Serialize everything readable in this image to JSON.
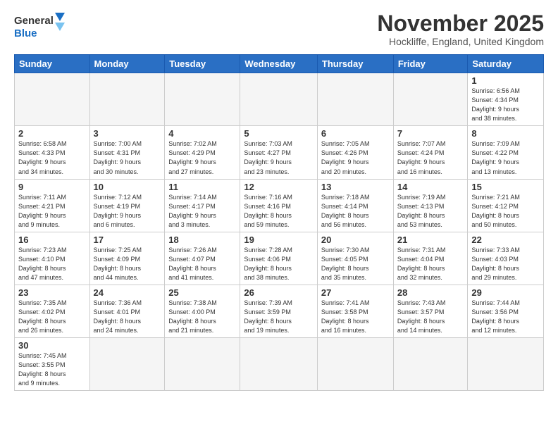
{
  "header": {
    "logo_text_general": "General",
    "logo_text_blue": "Blue",
    "month_title": "November 2025",
    "location": "Hockliffe, England, United Kingdom"
  },
  "weekdays": [
    "Sunday",
    "Monday",
    "Tuesday",
    "Wednesday",
    "Thursday",
    "Friday",
    "Saturday"
  ],
  "weeks": [
    [
      {
        "day": "",
        "info": ""
      },
      {
        "day": "",
        "info": ""
      },
      {
        "day": "",
        "info": ""
      },
      {
        "day": "",
        "info": ""
      },
      {
        "day": "",
        "info": ""
      },
      {
        "day": "",
        "info": ""
      },
      {
        "day": "1",
        "info": "Sunrise: 6:56 AM\nSunset: 4:34 PM\nDaylight: 9 hours\nand 38 minutes."
      }
    ],
    [
      {
        "day": "2",
        "info": "Sunrise: 6:58 AM\nSunset: 4:33 PM\nDaylight: 9 hours\nand 34 minutes."
      },
      {
        "day": "3",
        "info": "Sunrise: 7:00 AM\nSunset: 4:31 PM\nDaylight: 9 hours\nand 30 minutes."
      },
      {
        "day": "4",
        "info": "Sunrise: 7:02 AM\nSunset: 4:29 PM\nDaylight: 9 hours\nand 27 minutes."
      },
      {
        "day": "5",
        "info": "Sunrise: 7:03 AM\nSunset: 4:27 PM\nDaylight: 9 hours\nand 23 minutes."
      },
      {
        "day": "6",
        "info": "Sunrise: 7:05 AM\nSunset: 4:26 PM\nDaylight: 9 hours\nand 20 minutes."
      },
      {
        "day": "7",
        "info": "Sunrise: 7:07 AM\nSunset: 4:24 PM\nDaylight: 9 hours\nand 16 minutes."
      },
      {
        "day": "8",
        "info": "Sunrise: 7:09 AM\nSunset: 4:22 PM\nDaylight: 9 hours\nand 13 minutes."
      }
    ],
    [
      {
        "day": "9",
        "info": "Sunrise: 7:11 AM\nSunset: 4:21 PM\nDaylight: 9 hours\nand 9 minutes."
      },
      {
        "day": "10",
        "info": "Sunrise: 7:12 AM\nSunset: 4:19 PM\nDaylight: 9 hours\nand 6 minutes."
      },
      {
        "day": "11",
        "info": "Sunrise: 7:14 AM\nSunset: 4:17 PM\nDaylight: 9 hours\nand 3 minutes."
      },
      {
        "day": "12",
        "info": "Sunrise: 7:16 AM\nSunset: 4:16 PM\nDaylight: 8 hours\nand 59 minutes."
      },
      {
        "day": "13",
        "info": "Sunrise: 7:18 AM\nSunset: 4:14 PM\nDaylight: 8 hours\nand 56 minutes."
      },
      {
        "day": "14",
        "info": "Sunrise: 7:19 AM\nSunset: 4:13 PM\nDaylight: 8 hours\nand 53 minutes."
      },
      {
        "day": "15",
        "info": "Sunrise: 7:21 AM\nSunset: 4:12 PM\nDaylight: 8 hours\nand 50 minutes."
      }
    ],
    [
      {
        "day": "16",
        "info": "Sunrise: 7:23 AM\nSunset: 4:10 PM\nDaylight: 8 hours\nand 47 minutes."
      },
      {
        "day": "17",
        "info": "Sunrise: 7:25 AM\nSunset: 4:09 PM\nDaylight: 8 hours\nand 44 minutes."
      },
      {
        "day": "18",
        "info": "Sunrise: 7:26 AM\nSunset: 4:07 PM\nDaylight: 8 hours\nand 41 minutes."
      },
      {
        "day": "19",
        "info": "Sunrise: 7:28 AM\nSunset: 4:06 PM\nDaylight: 8 hours\nand 38 minutes."
      },
      {
        "day": "20",
        "info": "Sunrise: 7:30 AM\nSunset: 4:05 PM\nDaylight: 8 hours\nand 35 minutes."
      },
      {
        "day": "21",
        "info": "Sunrise: 7:31 AM\nSunset: 4:04 PM\nDaylight: 8 hours\nand 32 minutes."
      },
      {
        "day": "22",
        "info": "Sunrise: 7:33 AM\nSunset: 4:03 PM\nDaylight: 8 hours\nand 29 minutes."
      }
    ],
    [
      {
        "day": "23",
        "info": "Sunrise: 7:35 AM\nSunset: 4:02 PM\nDaylight: 8 hours\nand 26 minutes."
      },
      {
        "day": "24",
        "info": "Sunrise: 7:36 AM\nSunset: 4:01 PM\nDaylight: 8 hours\nand 24 minutes."
      },
      {
        "day": "25",
        "info": "Sunrise: 7:38 AM\nSunset: 4:00 PM\nDaylight: 8 hours\nand 21 minutes."
      },
      {
        "day": "26",
        "info": "Sunrise: 7:39 AM\nSunset: 3:59 PM\nDaylight: 8 hours\nand 19 minutes."
      },
      {
        "day": "27",
        "info": "Sunrise: 7:41 AM\nSunset: 3:58 PM\nDaylight: 8 hours\nand 16 minutes."
      },
      {
        "day": "28",
        "info": "Sunrise: 7:43 AM\nSunset: 3:57 PM\nDaylight: 8 hours\nand 14 minutes."
      },
      {
        "day": "29",
        "info": "Sunrise: 7:44 AM\nSunset: 3:56 PM\nDaylight: 8 hours\nand 12 minutes."
      }
    ],
    [
      {
        "day": "30",
        "info": "Sunrise: 7:45 AM\nSunset: 3:55 PM\nDaylight: 8 hours\nand 9 minutes."
      },
      {
        "day": "",
        "info": ""
      },
      {
        "day": "",
        "info": ""
      },
      {
        "day": "",
        "info": ""
      },
      {
        "day": "",
        "info": ""
      },
      {
        "day": "",
        "info": ""
      },
      {
        "day": "",
        "info": ""
      }
    ]
  ]
}
